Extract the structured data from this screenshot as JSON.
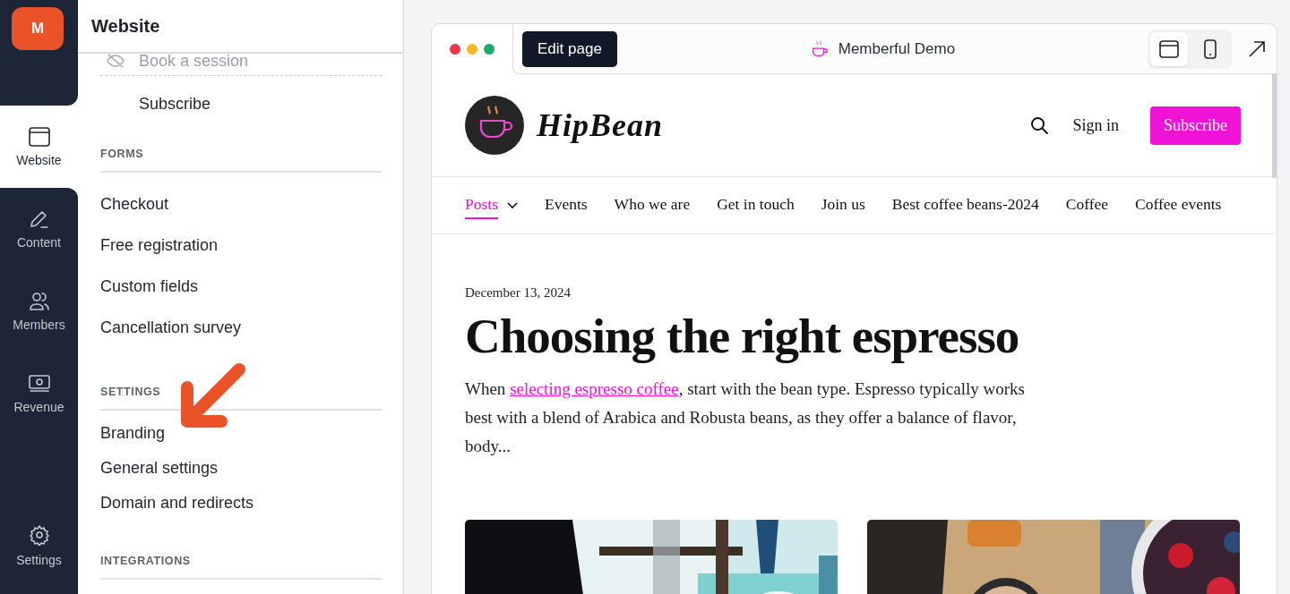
{
  "rail": {
    "logo": "M",
    "items": [
      {
        "label": "Website",
        "selected": true
      },
      {
        "label": "Content",
        "selected": false
      },
      {
        "label": "Members",
        "selected": false
      },
      {
        "label": "Revenue",
        "selected": false
      }
    ],
    "settings": "Settings"
  },
  "panel": {
    "title": "Website",
    "pages": [
      {
        "label": "Book a session",
        "hidden": true
      },
      {
        "label": "Subscribe",
        "hidden": false
      }
    ],
    "sections": [
      {
        "heading": "FORMS",
        "items": [
          "Checkout",
          "Free registration",
          "Custom fields",
          "Cancellation survey"
        ]
      },
      {
        "heading": "SETTINGS",
        "items": [
          "Branding",
          "General settings",
          "Domain and redirects"
        ]
      },
      {
        "heading": "INTEGRATIONS"
      }
    ]
  },
  "preview": {
    "toolbar": {
      "edit_button": "Edit page",
      "site_name": "Memberful Demo",
      "views": [
        {
          "kind": "desktop",
          "selected": true
        },
        {
          "kind": "mobile",
          "selected": false
        }
      ]
    },
    "site": {
      "brand": "HipBean",
      "sign_in": "Sign in",
      "subscribe": "Subscribe",
      "nav": [
        {
          "label": "Posts",
          "selected": true,
          "dropdown": true
        },
        {
          "label": "Events",
          "selected": false,
          "dropdown": false
        },
        {
          "label": "Who we are",
          "selected": false,
          "dropdown": false
        },
        {
          "label": "Get in touch",
          "selected": false,
          "dropdown": false
        },
        {
          "label": "Join us",
          "selected": false,
          "dropdown": false
        },
        {
          "label": "Best coffee beans-2024",
          "selected": false,
          "dropdown": false
        },
        {
          "label": "Coffee",
          "selected": false,
          "dropdown": false
        },
        {
          "label": "Coffee events",
          "selected": false,
          "dropdown": false
        }
      ],
      "post": {
        "date": "December 13, 2024",
        "title": "Choosing the right espresso",
        "excerpt_before": "When ",
        "link": "selecting espresso coffee",
        "excerpt_after": ", start with the bean type. Espresso typically works best with a blend of Arabica and Robusta beans, as they offer a balance of flavor, body..."
      }
    }
  }
}
